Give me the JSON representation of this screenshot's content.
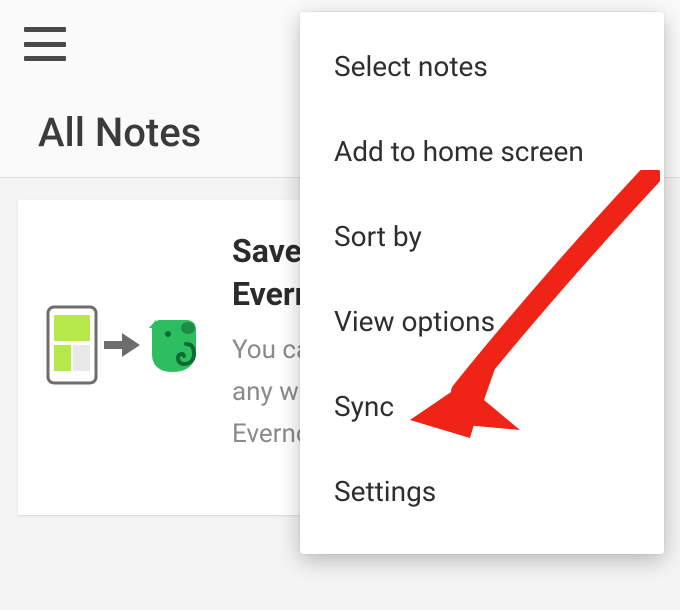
{
  "header": {
    "title": "All Notes"
  },
  "card": {
    "title": "Save\nEverr",
    "body": "You ca\nany we\nEvernot"
  },
  "menu": {
    "items": [
      {
        "label": "Select notes"
      },
      {
        "label": "Add to home screen"
      },
      {
        "label": "Sort by"
      },
      {
        "label": "View options"
      },
      {
        "label": "Sync"
      },
      {
        "label": "Settings"
      }
    ]
  },
  "icons": {
    "hamburger": "hamburger-icon",
    "phone": "phone-icon",
    "arrow_right": "arrow-right-icon",
    "evernote": "evernote-icon",
    "annotation_arrow": "red-arrow-annotation"
  },
  "colors": {
    "accent_green": "#2dbe60",
    "accent_green_light": "#b7e84a",
    "annotation_red": "#f02416"
  }
}
